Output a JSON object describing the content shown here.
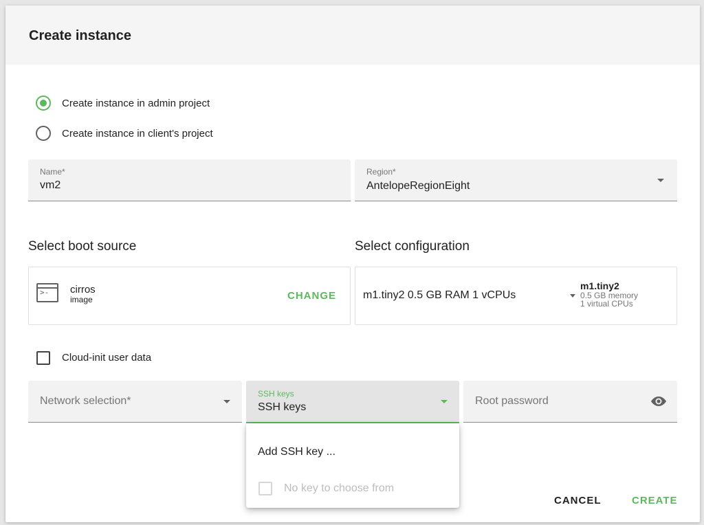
{
  "dialog": {
    "title": "Create instance"
  },
  "project_options": [
    {
      "label": "Create instance in admin project",
      "selected": true
    },
    {
      "label": "Create instance in client's project",
      "selected": false
    }
  ],
  "name_field": {
    "label": "Name*",
    "value": "vm2"
  },
  "region_field": {
    "label": "Region*",
    "value": "AntelopeRegionEight",
    "icon": "caret-down-icon"
  },
  "boot_source": {
    "title": "Select boot source",
    "name": "cirros",
    "type": "image",
    "icon": "terminal-icon",
    "change_label": "CHANGE"
  },
  "configuration": {
    "title": "Select configuration",
    "selected": "m1.tiny2 0.5 GB RAM 1 vCPUs",
    "flavor_name": "m1.tiny2",
    "flavor_memory": "0.5 GB memory",
    "flavor_cpus": "1 virtual CPUs"
  },
  "cloud_init": {
    "label": "Cloud-init user data",
    "checked": false
  },
  "network_field": {
    "placeholder": "Network selection*"
  },
  "ssh_field": {
    "label": "SSH keys",
    "value": "SSH keys"
  },
  "password_field": {
    "placeholder": "Root password",
    "icon": "eye-icon"
  },
  "ssh_dropdown": {
    "add_item": "Add SSH key ...",
    "empty_item": "No key to choose from"
  },
  "actions": {
    "cancel": "CANCEL",
    "create": "CREATE"
  },
  "colors": {
    "accent": "#5cb85c",
    "field_bg": "#f2f2f2",
    "header_bg": "#f5f5f5"
  }
}
